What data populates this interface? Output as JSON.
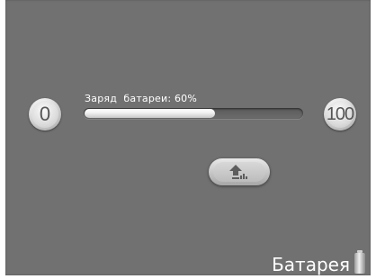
{
  "screen": {
    "title": "Батарея",
    "background": "#717171"
  },
  "charge": {
    "label": "Заряд  батареи: 60%",
    "level": 0.6,
    "min_label": "0",
    "max_label": "100"
  },
  "icons": {
    "apply_button": "upload-arrow-icon",
    "title_icon": "battery-icon"
  }
}
